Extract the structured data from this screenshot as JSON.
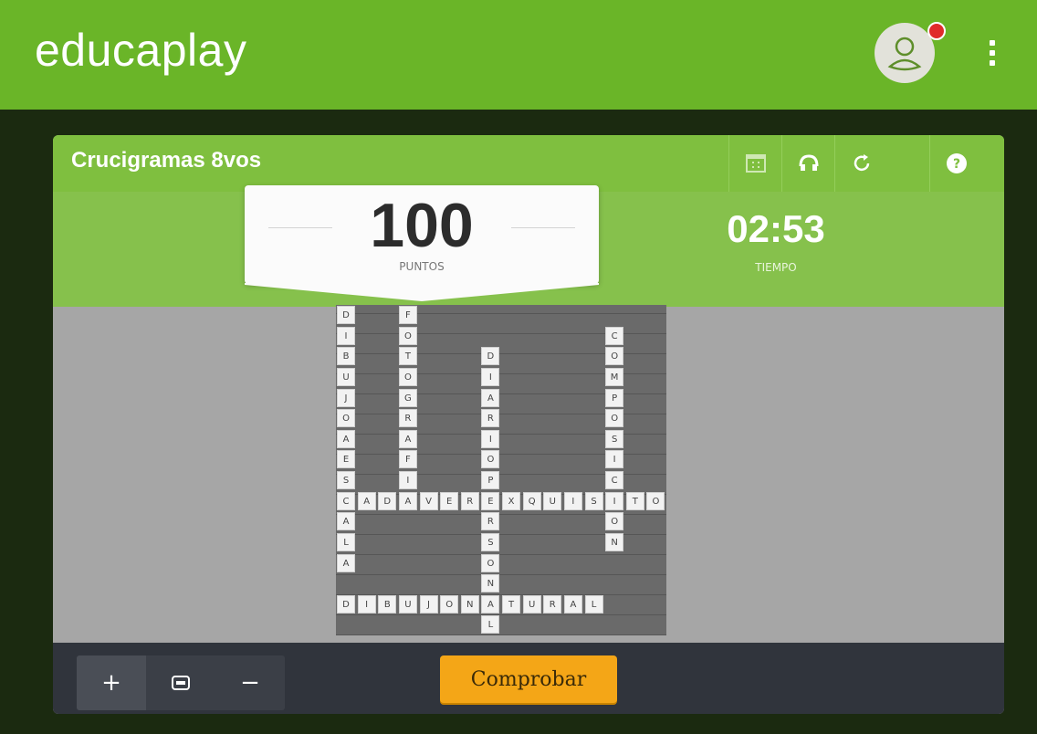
{
  "header": {
    "logo": "educaplay",
    "colors": {
      "bar": "#6ab528",
      "notification": "#e02b2b"
    },
    "icons": [
      "user-avatar-icon",
      "notification-dot",
      "kebab-menu-icon"
    ]
  },
  "activity": {
    "title": "Crucigramas 8vos",
    "toolbar_icons": [
      "fullscreen-icon",
      "headphones-icon",
      "restart-icon",
      "help-icon"
    ],
    "score": {
      "value": "100",
      "label": "PUNTOS"
    },
    "timer": {
      "value": "02:53",
      "label": "TIEMPO"
    }
  },
  "crossword": {
    "words": [
      {
        "text": "DIBUJOAESCALA",
        "direction": "down",
        "row": 0,
        "col": 0
      },
      {
        "text": "FOTOGRAFI",
        "direction": "down",
        "row": 0,
        "col": 3
      },
      {
        "text": "DIARIOPERSONAL",
        "direction": "down",
        "row": 2,
        "col": 7
      },
      {
        "text": "COMPOSICION",
        "direction": "down",
        "row": 1,
        "col": 13
      },
      {
        "text": "CADAVEREXQUISITO",
        "direction": "across",
        "row": 9,
        "col": 0
      },
      {
        "text": "DIBUJONATURAL",
        "direction": "across",
        "row": 14,
        "col": 0
      }
    ],
    "rows": 16,
    "cols": 16
  },
  "footer": {
    "zoom_in": "+",
    "zoom_out": "−",
    "check_label": "Comprobar",
    "colors": {
      "check_button": "#f4a617"
    }
  }
}
